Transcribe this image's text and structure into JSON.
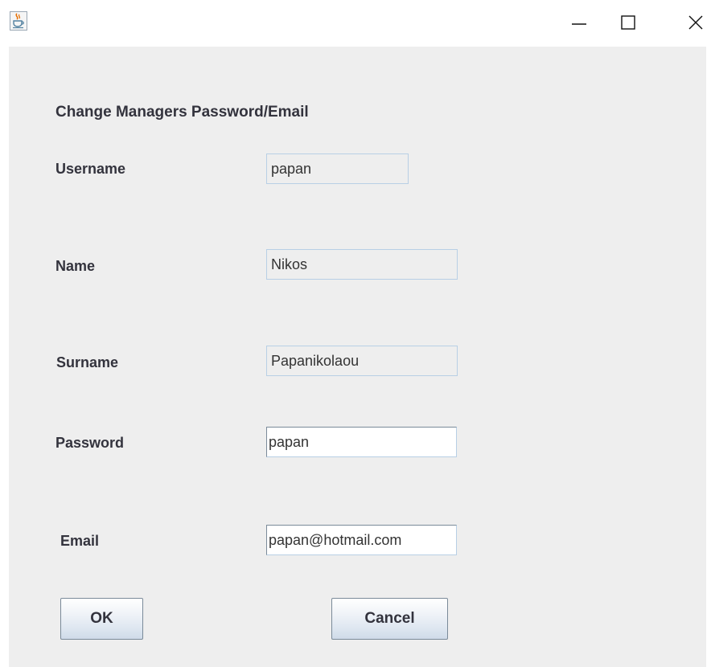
{
  "window": {
    "title_bar_icon": "java-cup-icon",
    "controls": {
      "minimize_icon": "minimize-icon",
      "maximize_icon": "maximize-icon",
      "close_icon": "close-icon"
    }
  },
  "form": {
    "heading": "Change Managers Password/Email",
    "fields": {
      "username": {
        "label": "Username",
        "value": "papan"
      },
      "name": {
        "label": "Name",
        "value": "Nikos"
      },
      "surname": {
        "label": "Surname",
        "value": "Papanikolaou"
      },
      "password": {
        "label": "Password",
        "value": "papan"
      },
      "email": {
        "label": "Email",
        "value": "papan@hotmail.com"
      }
    },
    "buttons": {
      "ok": "OK",
      "cancel": "Cancel"
    }
  },
  "colors": {
    "panel_background": "#eeeeee",
    "field_border": "#b8cfe5",
    "text": "#33333d"
  }
}
